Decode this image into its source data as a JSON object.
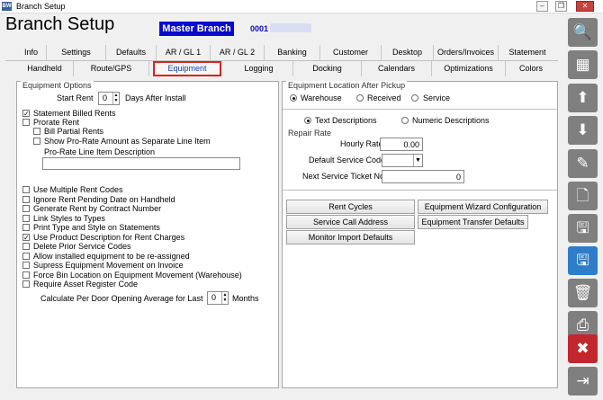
{
  "window": {
    "title": "Branch Setup",
    "app_icon": "app-icon"
  },
  "header": {
    "title": "Branch Setup",
    "branch_name": "Master Branch",
    "branch_code": "0001"
  },
  "tabs_row1": [
    "Info",
    "Settings",
    "Defaults",
    "AR / GL 1",
    "AR / GL 2",
    "Banking",
    "Customer",
    "Desktop",
    "Orders/Invoices",
    "Statement"
  ],
  "tabs_row2": [
    "Handheld",
    "Route/GPS",
    "Equipment",
    "Logging",
    "Docking",
    "Calendars",
    "Optimizations",
    "Colors"
  ],
  "active_tab": "Equipment",
  "equipment_options": {
    "title": "Equipment Options",
    "start_rent_label": "Start Rent",
    "start_rent_value": "0",
    "days_after_label": "Days After Install",
    "statement_billed_rents": "Statement Billed Rents",
    "prorate_rent": "Prorate Rent",
    "bill_partial_rents": "Bill Partial Rents",
    "show_prorate_amount": "Show Pro-Rate Amount as Separate Line Item",
    "prorate_desc_label": "Pro-Rate Line Item Description",
    "prorate_desc_value": "",
    "options": [
      {
        "label": "Use Multiple Rent Codes",
        "checked": false
      },
      {
        "label": "Ignore Rent Pending Date on Handheld",
        "checked": false
      },
      {
        "label": "Generate Rent by Contract Number",
        "checked": false
      },
      {
        "label": "Link Styles to Types",
        "checked": false
      },
      {
        "label": "Print Type and Style on Statements",
        "checked": false
      },
      {
        "label": "Use Product Description for Rent Charges",
        "checked": true
      },
      {
        "label": "Delete Prior Service Codes",
        "checked": false
      },
      {
        "label": "Allow installed equipment to be re-assigned",
        "checked": false
      },
      {
        "label": "Supress Equipment Movement on Invoice",
        "checked": false
      },
      {
        "label": "Force Bin Location on Equipment Movement (Warehouse)",
        "checked": false
      },
      {
        "label": "Require Asset Register Code",
        "checked": false
      }
    ],
    "per_door_label": "Calculate Per Door Opening Average for Last",
    "per_door_value": "0",
    "months_label": "Months"
  },
  "location_after_pickup": {
    "title": "Equipment Location After Pickup",
    "options": [
      "Warehouse",
      "Received",
      "Service"
    ],
    "selected": "Warehouse"
  },
  "descriptions": {
    "options": [
      "Text Descriptions",
      "Numeric Descriptions"
    ],
    "selected": "Text Descriptions"
  },
  "repair_rate": {
    "title": "Repair Rate",
    "hourly_rate_label": "Hourly Rate",
    "hourly_rate_value": "0.00",
    "default_service_code_label": "Default Service Code",
    "default_service_code_value": "",
    "next_ticket_label": "Next Service Ticket No.",
    "next_ticket_value": "0"
  },
  "buttons": {
    "rent_cycles": "Rent Cycles",
    "wizard_config": "Equipment Wizard Configuration",
    "service_call_address": "Service Call Address",
    "transfer_defaults": "Equipment Transfer Defaults",
    "monitor_import": "Monitor Import Defaults"
  },
  "toolbar_icons": [
    "search-icon",
    "grid-icon",
    "arrow-up-icon",
    "arrow-down-icon",
    "pencil-icon",
    "new-document-icon",
    "save-new-icon",
    "save-icon",
    "trash-icon",
    "print-icon",
    "close-icon",
    "exit-icon"
  ]
}
